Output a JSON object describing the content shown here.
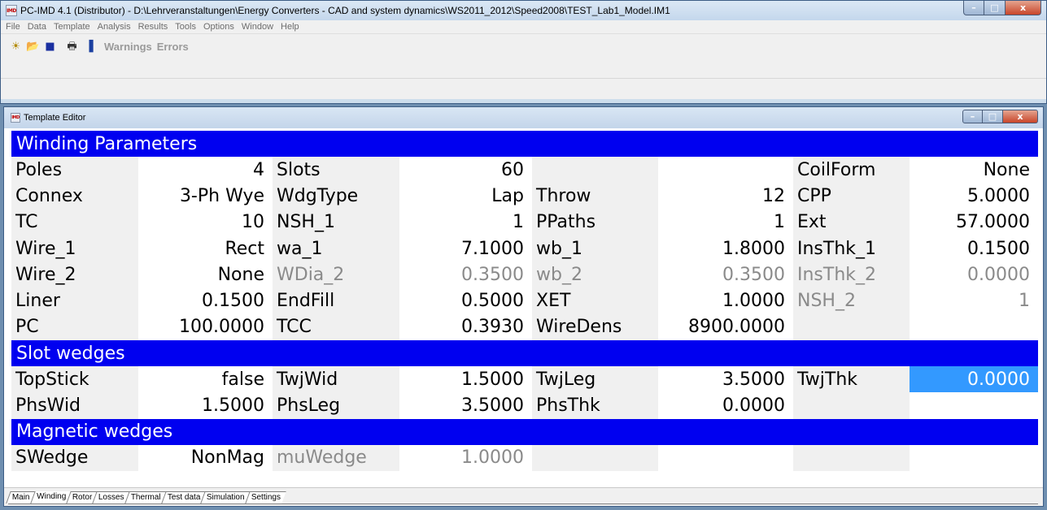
{
  "window": {
    "title": "PC-IMD 4.1 (Distributor) - D:\\Lehrveranstaltungen\\Energy Converters - CAD and system dynamics\\WS2011_2012\\Speed2008\\TEST_Lab1_Model.IM1",
    "icon_text": "IMD",
    "min_glyph": "–",
    "max_glyph": "□",
    "close_glyph": "x"
  },
  "menu": [
    "File",
    "Data",
    "Template",
    "Analysis",
    "Results",
    "Tools",
    "Options",
    "Window",
    "Help"
  ],
  "toolbar": {
    "new_icon": "☀",
    "open_icon": "📂",
    "save_icon": "■",
    "print_icon": "🖶",
    "chart_icon": "▐",
    "warnings_label": "Warnings",
    "errors_label": "Errors"
  },
  "editor": {
    "title": "Template Editor",
    "icon_text": "IMD",
    "sections": {
      "winding": "Winding Parameters",
      "slot": "Slot wedges",
      "magnetic": "Magnetic wedges"
    },
    "rows": [
      [
        [
          "Poles",
          "4"
        ],
        [
          "Slots",
          "60"
        ],
        [
          "",
          ""
        ],
        [
          "CoilForm",
          "None"
        ]
      ],
      [
        [
          "Connex",
          "3-Ph Wye"
        ],
        [
          "WdgType",
          "Lap"
        ],
        [
          "Throw",
          "12"
        ],
        [
          "CPP",
          "5.0000"
        ]
      ],
      [
        [
          "TC",
          "10"
        ],
        [
          "NSH_1",
          "1"
        ],
        [
          "PPaths",
          "1"
        ],
        [
          "Ext",
          "57.0000"
        ]
      ],
      [
        [
          "Wire_1",
          "Rect"
        ],
        [
          "wa_1",
          "7.1000"
        ],
        [
          "wb_1",
          "1.8000"
        ],
        [
          "InsThk_1",
          "0.1500"
        ]
      ],
      [
        [
          "Wire_2",
          "None"
        ],
        [
          "WDia_2",
          "0.3500"
        ],
        [
          "wb_2",
          "0.3500"
        ],
        [
          "InsThk_2",
          "0.0000"
        ]
      ],
      [
        [
          "Liner",
          "0.1500"
        ],
        [
          "EndFill",
          "0.5000"
        ],
        [
          "XET",
          "1.0000"
        ],
        [
          "NSH_2",
          "1"
        ]
      ],
      [
        [
          "PC",
          "100.0000"
        ],
        [
          "TCC",
          "0.3930"
        ],
        [
          "WireDens",
          "8900.0000"
        ],
        [
          "",
          ""
        ]
      ],
      [
        [
          "TopStick",
          "false"
        ],
        [
          "TwjWid",
          "1.5000"
        ],
        [
          "TwjLeg",
          "3.5000"
        ],
        [
          "TwjThk",
          "0.0000"
        ]
      ],
      [
        [
          "PhsWid",
          "1.5000"
        ],
        [
          "PhsLeg",
          "3.5000"
        ],
        [
          "PhsThk",
          "0.0000"
        ],
        [
          "",
          ""
        ]
      ],
      [
        [
          "SWedge",
          "NonMag"
        ],
        [
          "muWedge",
          "1.0000"
        ],
        [
          "",
          ""
        ],
        [
          "",
          ""
        ]
      ]
    ],
    "tabs": [
      "Main",
      "Winding",
      "Rotor",
      "Losses",
      "Thermal",
      "Test data",
      "Simulation",
      "Settings"
    ],
    "active_tab": "Winding"
  }
}
